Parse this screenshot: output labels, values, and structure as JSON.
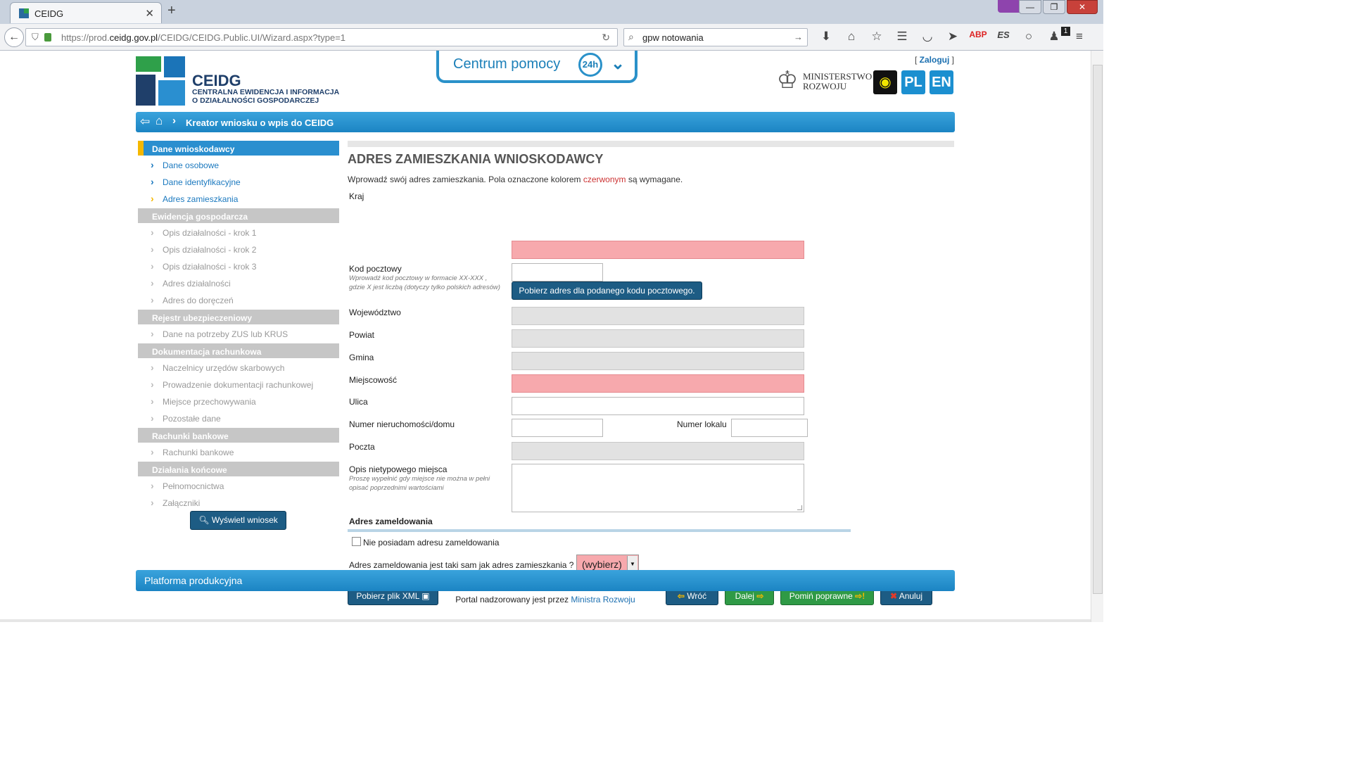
{
  "browser": {
    "tab_title": "CEIDG",
    "url_prefix": "https://prod.",
    "url_domain": "ceidg.gov.pl",
    "url_path": "/CEIDG/CEIDG.Public.UI/Wizard.aspx?type=1",
    "search_query": "gpw notowania",
    "notification_count": "1"
  },
  "header": {
    "logo_title": "CEIDG",
    "logo_subtitle_1": "CENTRALNA EWIDENCJA I INFORMACJA",
    "logo_subtitle_2": "O DZIAŁALNOŚCI GOSPODARCZEJ",
    "help_label": "Centrum pomocy",
    "help_badge": "24h",
    "login_open": "[ ",
    "login_label": "Zaloguj",
    "login_close": " ]",
    "ministry_1": "MINISTERSTWO",
    "ministry_2": "ROZWOJU",
    "lang_pl": "PL",
    "lang_en": "EN"
  },
  "breadcrumb_title": "Kreator wniosku o wpis do CEIDG",
  "sidebar": {
    "sections": [
      {
        "label": "Dane wnioskodawcy",
        "items": [
          "Dane osobowe",
          "Dane identyfikacyjne",
          "Adres zamieszkania"
        ]
      },
      {
        "label": "Ewidencja gospodarcza",
        "items": [
          "Opis działalności - krok 1",
          "Opis działalności - krok 2",
          "Opis działalności - krok 3",
          "Adres działalności",
          "Adres do doręczeń"
        ]
      },
      {
        "label": "Rejestr ubezpieczeniowy",
        "items": [
          "Dane na potrzeby ZUS lub KRUS"
        ]
      },
      {
        "label": "Dokumentacja rachunkowa",
        "items": [
          "Naczelnicy urzędów skarbowych",
          "Prowadzenie dokumentacji rachunkowej",
          "Miejsce przechowywania",
          "Pozostałe dane"
        ]
      },
      {
        "label": "Rachunki bankowe",
        "items": [
          "Rachunki bankowe"
        ]
      },
      {
        "label": "Działania końcowe",
        "items": [
          "Pełnomocnictwa",
          "Załączniki"
        ]
      }
    ],
    "show_button": "Wyświetl wniosek"
  },
  "form": {
    "title": "ADRES ZAMIESZKANIA WNIOSKODAWCY",
    "intro_a": "Wprowadź swój adres zamieszkania. Pola oznaczone kolorem ",
    "intro_red": "czerwonym",
    "intro_b": " są wymagane.",
    "kraj": "Kraj",
    "kod": "Kod pocztowy",
    "kod_hint": "Wprowadź kod pocztowy w formacie XX-XXX , gdzie X jest liczbą (dotyczy tylko polskich adresów)",
    "fetch_button": "Pobierz adres dla podanego kodu pocztowego.",
    "wojewodztwo": "Województwo",
    "powiat": "Powiat",
    "gmina": "Gmina",
    "miejscowosc": "Miejscowość",
    "ulica": "Ulica",
    "numer_domu": "Numer nieruchomości/domu",
    "numer_lokalu": "Numer lokalu",
    "poczta": "Poczta",
    "opis": "Opis nietypowego miejsca",
    "opis_hint": "Proszę wypełnić gdy miejsce nie można w pełni opisać poprzednimi wartościami",
    "zameldowanie_title": "Adres zameldowania",
    "no_zameldowanie": "Nie posiadam adresu zameldowania",
    "same_question": "Adres zameldowania jest taki sam jak adres zamieszkania ?",
    "select_value": "(wybierz)"
  },
  "buttons": {
    "xml": "Pobierz plik XML",
    "back": "Wróć",
    "next": "Dalej",
    "skip": "Pomiń poprawne",
    "cancel": "Anuluj"
  },
  "footer": {
    "bar": "Platforma produkcyjna",
    "text": "Portal nadzorowany jest przez ",
    "link": "Ministra Rozwoju"
  }
}
